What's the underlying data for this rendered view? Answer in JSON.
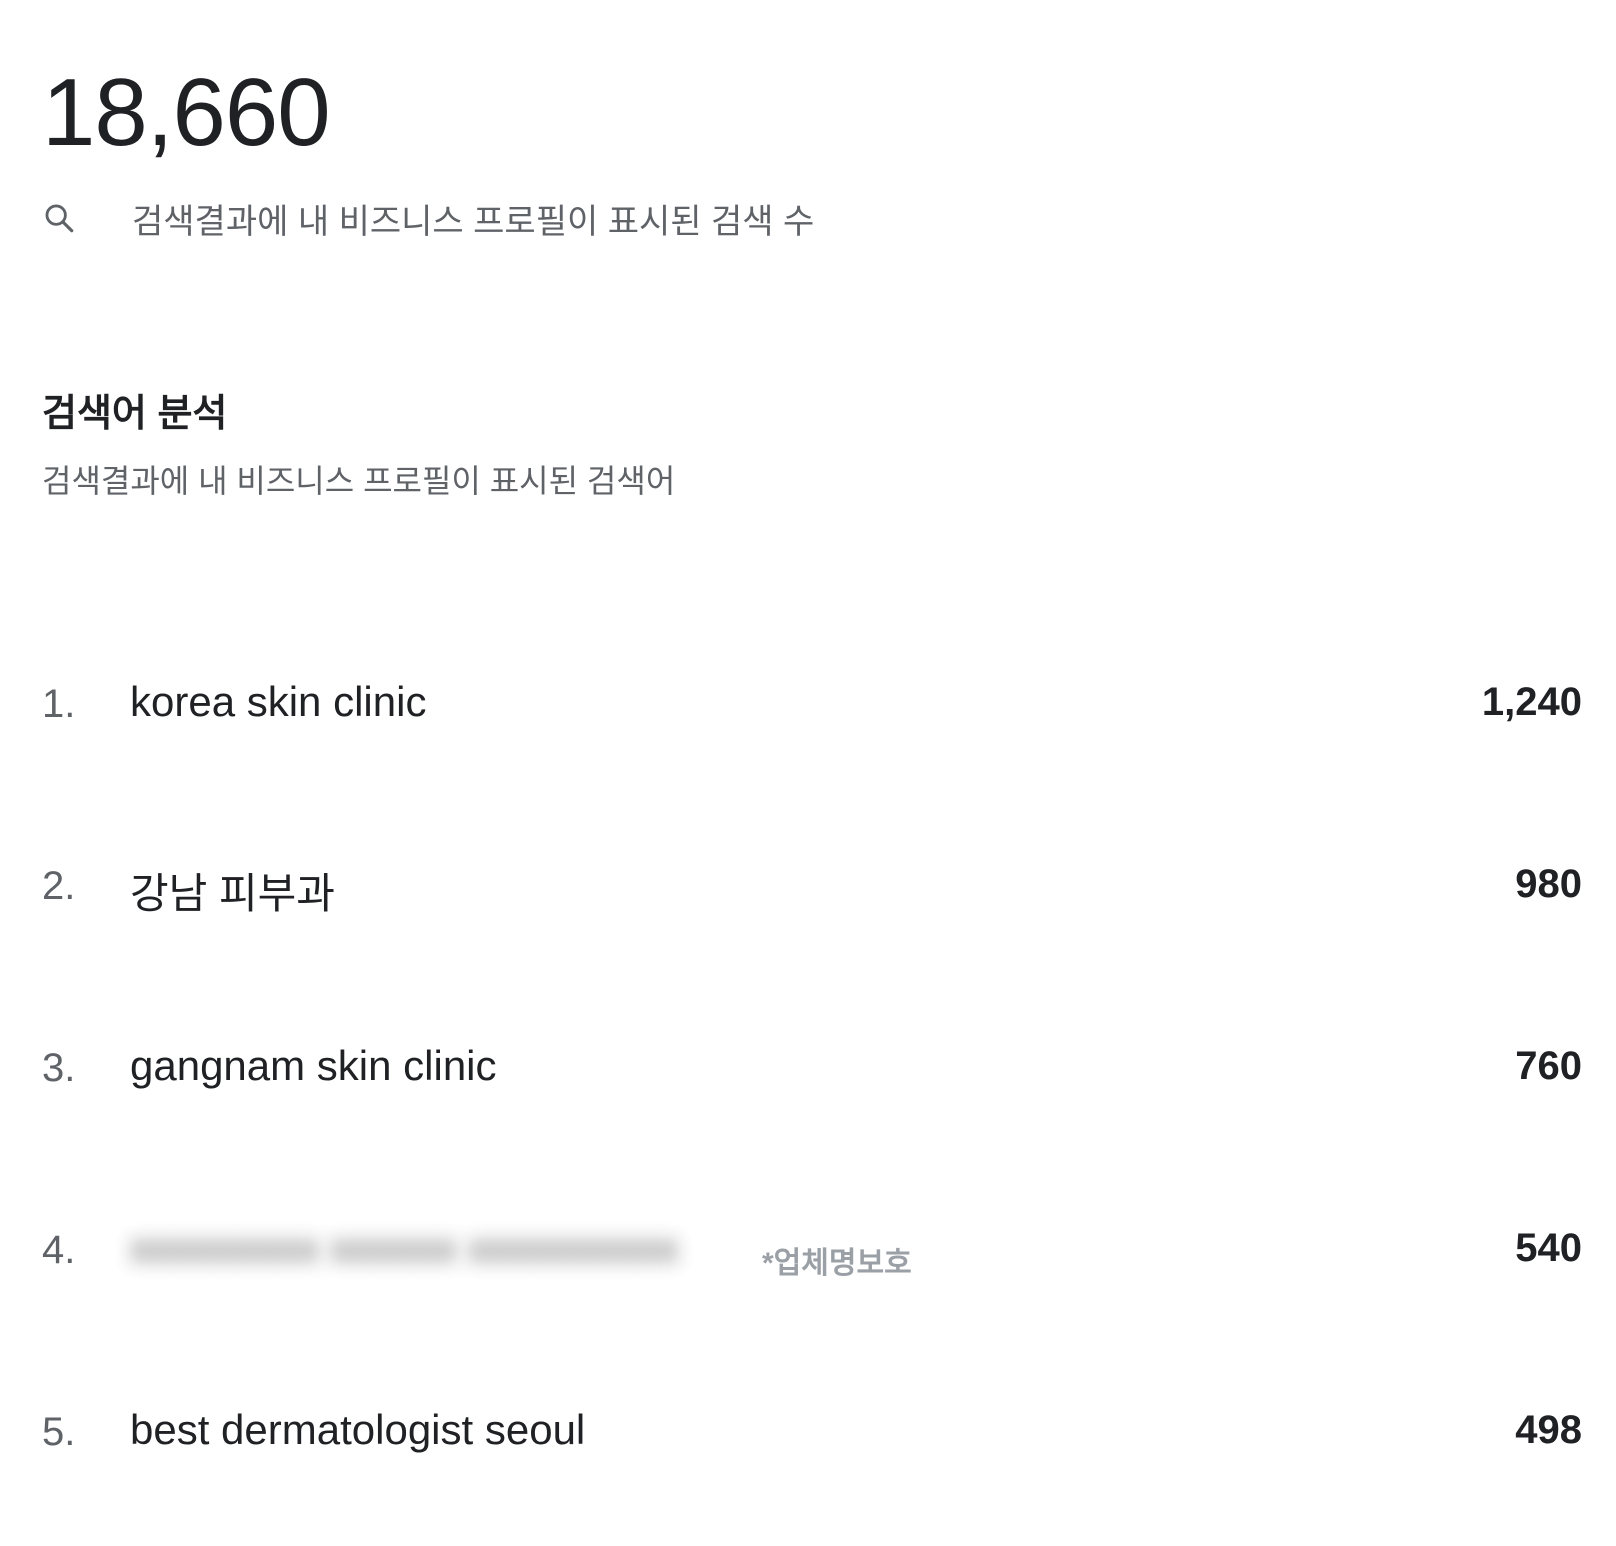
{
  "summary": {
    "total": "18,660",
    "metric_label": "검색결과에 내 비즈니스 프로필이 표시된 검색 수",
    "metric_icon": "search-icon"
  },
  "section": {
    "title": "검색어 분석",
    "subtitle": "검색결과에 내 비즈니스 프로필이 표시된 검색어"
  },
  "queries": [
    {
      "rank": "1.",
      "term": "korea skin clinic",
      "count": "1,240"
    },
    {
      "rank": "2.",
      "term": "강남 피부과",
      "count": "980"
    },
    {
      "rank": "3.",
      "term": "gangnam skin clinic",
      "count": "760"
    },
    {
      "rank": "4.",
      "term": "",
      "note": "*업체명보호",
      "count": "540"
    },
    {
      "rank": "5.",
      "term": "best dermatologist seoul",
      "count": "498"
    }
  ],
  "colors": {
    "primary_text": "#202124",
    "secondary_text": "#5f6368",
    "muted_note": "#9aa0a6"
  }
}
